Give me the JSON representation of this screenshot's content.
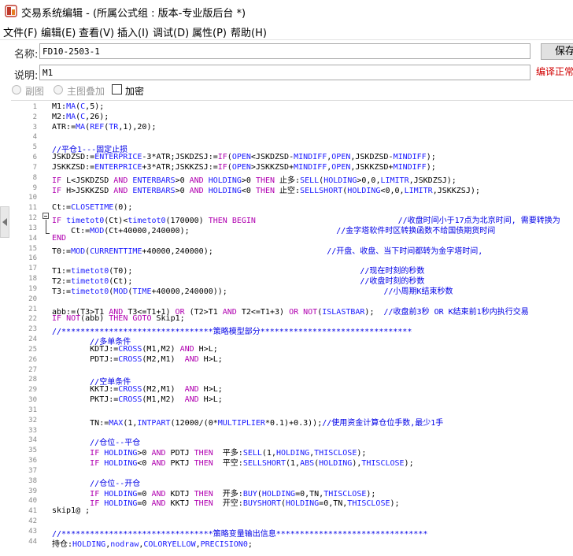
{
  "window": {
    "title": "交易系统编辑 - (所属公式组 : 版本-专业版后台 *)"
  },
  "menu": [
    "文件(F)",
    "编辑(E)",
    "查看(V)",
    "插入(I)",
    "调试(D)",
    "属性(P)",
    "帮助(H)"
  ],
  "form": {
    "name_label": "名称:",
    "name_value": "FD10-2503-1",
    "desc_label": "说明:",
    "desc_value": "M1",
    "save_label": "保存",
    "compile_status": "编译正常",
    "opt_subchart": "副图",
    "opt_mainoverlay": "主图叠加",
    "opt_encrypt": "加密"
  },
  "editor": {
    "line_numbers": [
      "1",
      "2",
      "3",
      "4",
      "5",
      "6",
      "7",
      "8",
      "9",
      "10",
      "11",
      "12",
      "13",
      "14",
      "15",
      "16",
      "17",
      "18",
      "19",
      "20",
      "21",
      "22",
      "23",
      "24",
      "25",
      "26",
      "27",
      "28",
      "29",
      "30",
      "31",
      "32",
      "33",
      "34",
      "35",
      "36",
      "37",
      "38",
      "39",
      "40",
      "41",
      "42",
      "43",
      "44"
    ],
    "lines": [
      [
        [
          "M1:",
          ""
        ],
        [
          "MA",
          "fn"
        ],
        [
          "(",
          ""
        ],
        [
          "C",
          "fn"
        ],
        [
          ",5);",
          ""
        ]
      ],
      [
        [
          "M2:",
          ""
        ],
        [
          "MA",
          "fn"
        ],
        [
          "(",
          ""
        ],
        [
          "C",
          "fn"
        ],
        [
          ",26);",
          ""
        ]
      ],
      [
        [
          "ATR:=",
          ""
        ],
        [
          "MA",
          "fn"
        ],
        [
          "(",
          ""
        ],
        [
          "REF",
          "fn"
        ],
        [
          "(",
          ""
        ],
        [
          "TR",
          "fn"
        ],
        [
          ",1),20);",
          ""
        ]
      ],
      [],
      [
        [
          "//平仓1---固定止损",
          "cm"
        ]
      ],
      [
        [
          "JSKDZSD:=",
          ""
        ],
        [
          "ENTERPRICE",
          "fn"
        ],
        [
          "-3*ATR;JSKDZSJ:=",
          ""
        ],
        [
          "IF",
          "kw"
        ],
        [
          "(",
          ""
        ],
        [
          "OPEN",
          "fn"
        ],
        [
          "<JSKDZSD-",
          ""
        ],
        [
          "MINDIFF",
          "fn"
        ],
        [
          ",",
          ""
        ],
        [
          "OPEN",
          "fn"
        ],
        [
          ",JSKDZSD-",
          ""
        ],
        [
          "MINDIFF",
          "fn"
        ],
        [
          ");",
          ""
        ]
      ],
      [
        [
          "JSKKZSD:=",
          ""
        ],
        [
          "ENTERPRICE",
          "fn"
        ],
        [
          "+3*ATR;JSKKZSJ:=",
          ""
        ],
        [
          "IF",
          "kw"
        ],
        [
          "(",
          ""
        ],
        [
          "OPEN",
          "fn"
        ],
        [
          ">JSKKZSD+",
          ""
        ],
        [
          "MINDIFF",
          "fn"
        ],
        [
          ",",
          ""
        ],
        [
          "OPEN",
          "fn"
        ],
        [
          ",JSKKZSD+",
          ""
        ],
        [
          "MINDIFF",
          "fn"
        ],
        [
          ");",
          ""
        ]
      ],
      [
        [
          "IF",
          "kw"
        ],
        [
          " L<JSKDZSD ",
          ""
        ],
        [
          "AND",
          "kw"
        ],
        [
          " ",
          ""
        ],
        [
          "ENTERBARS",
          "fn"
        ],
        [
          ">0 ",
          ""
        ],
        [
          "AND",
          "kw"
        ],
        [
          " ",
          ""
        ],
        [
          "HOLDING",
          "fn"
        ],
        [
          ">0 ",
          ""
        ],
        [
          "THEN",
          "kw"
        ],
        [
          " 止多:",
          ""
        ],
        [
          "SELL",
          "fn"
        ],
        [
          "(",
          ""
        ],
        [
          "HOLDING",
          "fn"
        ],
        [
          ">0,0,",
          ""
        ],
        [
          "LIMITR",
          "fn"
        ],
        [
          ",JSKDZSJ);",
          ""
        ]
      ],
      [
        [
          "IF",
          "kw"
        ],
        [
          " H>JSKKZSD ",
          ""
        ],
        [
          "AND",
          "kw"
        ],
        [
          " ",
          ""
        ],
        [
          "ENTERBARS",
          "fn"
        ],
        [
          ">0 ",
          ""
        ],
        [
          "AND",
          "kw"
        ],
        [
          " ",
          ""
        ],
        [
          "HOLDING",
          "fn"
        ],
        [
          "<0 ",
          ""
        ],
        [
          "THEN",
          "kw"
        ],
        [
          " 止空:",
          ""
        ],
        [
          "SELLSHORT",
          "fn"
        ],
        [
          "(",
          ""
        ],
        [
          "HOLDING",
          "fn"
        ],
        [
          "<0,0,",
          ""
        ],
        [
          "LIMITR",
          "fn"
        ],
        [
          ",JSKKZSJ);",
          ""
        ]
      ],
      [],
      [
        [
          "Ct:=",
          ""
        ],
        [
          "CLOSETIME",
          "fn"
        ],
        [
          "(0);",
          ""
        ]
      ],
      [
        [
          "IF",
          "kw"
        ],
        [
          " ",
          ""
        ],
        [
          "timetot0",
          "fn"
        ],
        [
          "(Ct)<",
          ""
        ],
        [
          "timetot0",
          "fn"
        ],
        [
          "(170000) ",
          ""
        ],
        [
          "THEN",
          "kw"
        ],
        [
          " ",
          ""
        ],
        [
          "BEGIN",
          "kw"
        ],
        [
          "                              ",
          ""
        ],
        [
          "//收盘时间小于17点为北京时间, 需要转换为",
          "cm"
        ]
      ],
      [
        [
          "    Ct:=",
          ""
        ],
        [
          "MOD",
          "fn"
        ],
        [
          "(Ct+40000,240000);",
          ""
        ],
        [
          "                               ",
          ""
        ],
        [
          "//金字塔软件时区转换函数不给国债期货时间",
          "cm"
        ]
      ],
      [
        [
          "END",
          "kw"
        ]
      ],
      [
        [
          "T0:=",
          ""
        ],
        [
          "MOD",
          "fn"
        ],
        [
          "(",
          ""
        ],
        [
          "CURRENTTIME",
          "fn"
        ],
        [
          "+40000,240000);",
          ""
        ],
        [
          "                        ",
          ""
        ],
        [
          "//开盘、收盘、当下时间都转为金字塔时间,",
          "cm"
        ]
      ],
      [],
      [
        [
          "T1:=",
          ""
        ],
        [
          "timetot0",
          "fn"
        ],
        [
          "(T0);",
          ""
        ],
        [
          "                                                ",
          ""
        ],
        [
          "//现在时刻的秒数",
          "cm"
        ]
      ],
      [
        [
          "T2:=",
          ""
        ],
        [
          "timetot0",
          "fn"
        ],
        [
          "(Ct);",
          ""
        ],
        [
          "                                                ",
          ""
        ],
        [
          "//收盘时刻的秒数",
          "cm"
        ]
      ],
      [
        [
          "T3:=",
          ""
        ],
        [
          "timetot0",
          "fn"
        ],
        [
          "(",
          ""
        ],
        [
          "MOD",
          "fn"
        ],
        [
          "(",
          ""
        ],
        [
          "TIME",
          "fn"
        ],
        [
          "+40000,240000));",
          ""
        ],
        [
          "                                 ",
          ""
        ],
        [
          "//小周期K结束秒数",
          "cm"
        ]
      ],
      [],
      [
        [
          "abb:=(T3>T1 ",
          ""
        ],
        [
          "AND",
          "kw"
        ],
        [
          " T3<=T1+1) ",
          ""
        ],
        [
          "OR",
          "kw"
        ],
        [
          " (T2>T1 ",
          ""
        ],
        [
          "AND",
          "kw"
        ],
        [
          " T2<=T1+3) ",
          ""
        ],
        [
          "OR",
          "kw"
        ],
        [
          " ",
          ""
        ],
        [
          "NOT",
          "kw"
        ],
        [
          "(",
          ""
        ],
        [
          "ISLASTBAR",
          "fn"
        ],
        [
          ");  ",
          ""
        ],
        [
          "//收盘前3秒 OR K结束前1秒内执行交易",
          "cm"
        ]
      ],
      [
        [
          "IF",
          "kw"
        ],
        [
          " ",
          ""
        ],
        [
          "NOT",
          "kw"
        ],
        [
          "(abb) ",
          ""
        ],
        [
          "THEN",
          "kw"
        ],
        [
          " ",
          ""
        ],
        [
          "GOTO",
          "kw"
        ],
        [
          " Skip1;",
          ""
        ]
      ],
      [
        [
          "//********************************策略模型部分********************************",
          "cm"
        ]
      ],
      [
        [
          "        //多单条件",
          "cm"
        ]
      ],
      [
        [
          "        KDTJ:=",
          ""
        ],
        [
          "CROSS",
          "fn"
        ],
        [
          "(M1,M2) ",
          ""
        ],
        [
          "AND",
          "kw"
        ],
        [
          " H>L;",
          ""
        ]
      ],
      [
        [
          "        PDTJ:=",
          ""
        ],
        [
          "CROSS",
          "fn"
        ],
        [
          "(M2,M1)  ",
          ""
        ],
        [
          "AND",
          "kw"
        ],
        [
          " H>L;",
          ""
        ]
      ],
      [],
      [
        [
          "        //空单条件",
          "cm"
        ]
      ],
      [
        [
          "        KKTJ:=",
          ""
        ],
        [
          "CROSS",
          "fn"
        ],
        [
          "(M2,M1)  ",
          ""
        ],
        [
          "AND",
          "kw"
        ],
        [
          " H>L;",
          ""
        ]
      ],
      [
        [
          "        PKTJ:=",
          ""
        ],
        [
          "CROSS",
          "fn"
        ],
        [
          "(M1,M2)  ",
          ""
        ],
        [
          "AND",
          "kw"
        ],
        [
          " H>L;",
          ""
        ]
      ],
      [],
      [
        [
          "        TN:=",
          ""
        ],
        [
          "MAX",
          "fn"
        ],
        [
          "(1,",
          ""
        ],
        [
          "INTPART",
          "fn"
        ],
        [
          "(12000/(0*",
          ""
        ],
        [
          "MULTIPLIER",
          "fn"
        ],
        [
          "*0.1)+0.3));",
          ""
        ],
        [
          "//使用资金计算仓位手数,最少1手",
          "cm"
        ]
      ],
      [],
      [
        [
          "        //仓位--平仓",
          "cm"
        ]
      ],
      [
        [
          "        ",
          ""
        ],
        [
          "IF",
          "kw"
        ],
        [
          " ",
          ""
        ],
        [
          "HOLDING",
          "fn"
        ],
        [
          ">0 ",
          ""
        ],
        [
          "AND",
          "kw"
        ],
        [
          " PDTJ ",
          ""
        ],
        [
          "THEN",
          "kw"
        ],
        [
          "  平多:",
          ""
        ],
        [
          "SELL",
          "fn"
        ],
        [
          "(1,",
          ""
        ],
        [
          "HOLDING",
          "fn"
        ],
        [
          ",",
          ""
        ],
        [
          "THISCLOSE",
          "fn"
        ],
        [
          ");",
          ""
        ]
      ],
      [
        [
          "        ",
          ""
        ],
        [
          "IF",
          "kw"
        ],
        [
          " ",
          ""
        ],
        [
          "HOLDING",
          "fn"
        ],
        [
          "<0 ",
          ""
        ],
        [
          "AND",
          "kw"
        ],
        [
          " PKTJ ",
          ""
        ],
        [
          "THEN",
          "kw"
        ],
        [
          "  平空:",
          ""
        ],
        [
          "SELLSHORT",
          "fn"
        ],
        [
          "(1,",
          ""
        ],
        [
          "ABS",
          "fn"
        ],
        [
          "(",
          ""
        ],
        [
          "HOLDING",
          "fn"
        ],
        [
          "),",
          ""
        ],
        [
          "THISCLOSE",
          "fn"
        ],
        [
          ");",
          ""
        ]
      ],
      [],
      [
        [
          "        //仓位--开仓",
          "cm"
        ]
      ],
      [
        [
          "        ",
          ""
        ],
        [
          "IF",
          "kw"
        ],
        [
          " ",
          ""
        ],
        [
          "HOLDING",
          "fn"
        ],
        [
          "=0 ",
          ""
        ],
        [
          "AND",
          "kw"
        ],
        [
          " KDTJ ",
          ""
        ],
        [
          "THEN",
          "kw"
        ],
        [
          "  开多:",
          ""
        ],
        [
          "BUY",
          "fn"
        ],
        [
          "(",
          ""
        ],
        [
          "HOLDING",
          "fn"
        ],
        [
          "=0,TN,",
          ""
        ],
        [
          "THISCLOSE",
          "fn"
        ],
        [
          ");",
          ""
        ]
      ],
      [
        [
          "        ",
          ""
        ],
        [
          "IF",
          "kw"
        ],
        [
          " ",
          ""
        ],
        [
          "HOLDING",
          "fn"
        ],
        [
          "=0 ",
          ""
        ],
        [
          "AND",
          "kw"
        ],
        [
          " KKTJ ",
          ""
        ],
        [
          "THEN",
          "kw"
        ],
        [
          "  开空:",
          ""
        ],
        [
          "BUYSHORT",
          "fn"
        ],
        [
          "(",
          ""
        ],
        [
          "HOLDING",
          "fn"
        ],
        [
          "=0,TN,",
          ""
        ],
        [
          "THISCLOSE",
          "fn"
        ],
        [
          ");",
          ""
        ]
      ],
      [
        [
          "skip1@ ;",
          ""
        ]
      ],
      [],
      [
        [
          "//********************************策略变量输出信息********************************",
          "cm"
        ]
      ],
      [
        [
          "持仓:",
          ""
        ],
        [
          "HOLDING",
          "fn"
        ],
        [
          ",",
          ""
        ],
        [
          "nodraw",
          "fn"
        ],
        [
          ",",
          ""
        ],
        [
          "COLORYELLOW",
          "fn"
        ],
        [
          ",",
          ""
        ],
        [
          "PRECISION0",
          "fn"
        ],
        [
          ";",
          ""
        ]
      ]
    ]
  },
  "icons": {
    "app": "app-icon",
    "fold": "fold-collapse-icon",
    "expand": "side-panel-expand-icon"
  }
}
